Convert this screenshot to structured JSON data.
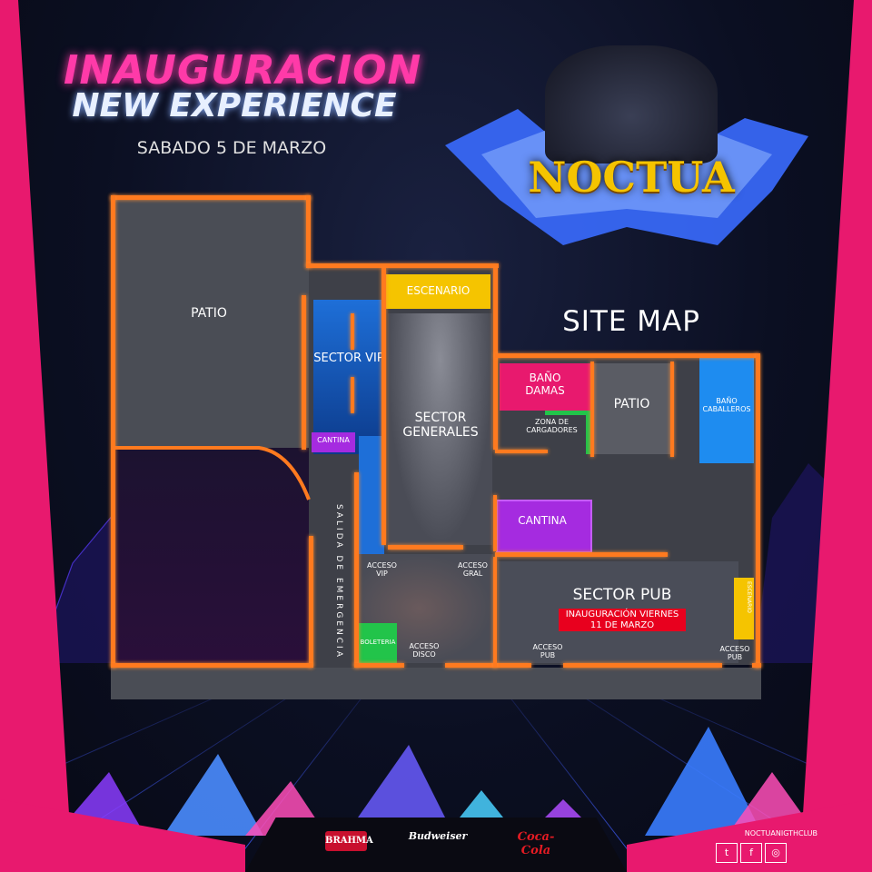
{
  "header": {
    "title_line1": "INAUGURACION",
    "title_line2": "NEW EXPERIENCE",
    "date": "SABADO 5 DE MARZO",
    "club_logo": "NOCTUA",
    "site_map": "SITE MAP"
  },
  "map": {
    "patio_left": "PATIO",
    "escenario": "ESCENARIO",
    "sector_vip": "SECTOR VIP",
    "cantina_small": "CANTINA",
    "sector_generales": "SECTOR GENERALES",
    "bano_damas": "BAÑO DAMAS",
    "patio_right": "PATIO",
    "bano_caballeros": "BAÑO CABALLEROS",
    "zona_cargadores": "ZONA DE CARGADORES",
    "cantina_main": "CANTINA",
    "salida_emergencia": "SALIDA DE EMERGENCIA",
    "acceso_vip": "ACCESO VIP",
    "acceso_gral": "ACCESO GRAL",
    "sector_pub": "SECTOR PUB",
    "inauguracion_note": "INAUGURACIÓN VIERNES 11 DE MARZO",
    "escenario_pub": "ESCENARIO",
    "boleteria": "BOLETERIA",
    "acceso_disco": "ACCESO DISCO",
    "acceso_pub1": "ACCESO PUB",
    "acceso_pub2": "ACCESO PUB"
  },
  "footer": {
    "sponsor1": "BRAHMA",
    "sponsor2": "Budweiser",
    "sponsor3": "Coca-Cola",
    "social_handle": "NOCTUANIGTHCLUB"
  },
  "colors": {
    "frame_pink": "#e8196e",
    "wall_orange": "#ff7a1f",
    "title_pink": "#ff3aa8",
    "stage_yellow": "#f5c400",
    "vip_blue": "#1e6fd8",
    "damas_pink": "#e8196e",
    "cantina_purple": "#a52be0",
    "boleteria_green": "#22c44a"
  }
}
